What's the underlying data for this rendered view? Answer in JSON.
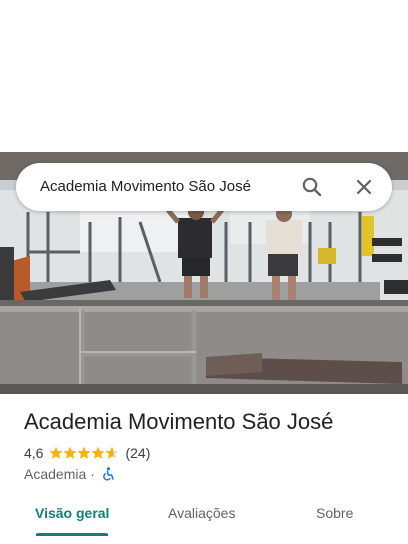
{
  "search": {
    "query": "Academia Movimento São José"
  },
  "place": {
    "title": "Academia Movimento São José",
    "rating": "4,6",
    "stars": 4.6,
    "reviews": "(24)",
    "category": "Academia",
    "separator": "·"
  },
  "tabs": [
    {
      "label": "Visão geral",
      "active": true
    },
    {
      "label": "Avaliações",
      "active": false
    },
    {
      "label": "Sobre",
      "active": false
    }
  ],
  "colors": {
    "accent": "#137e78",
    "star": "#f6b300",
    "accessibility": "#1a73e8"
  },
  "icons": {
    "search": "search-icon",
    "close": "close-icon",
    "accessibility": "wheelchair-icon"
  }
}
